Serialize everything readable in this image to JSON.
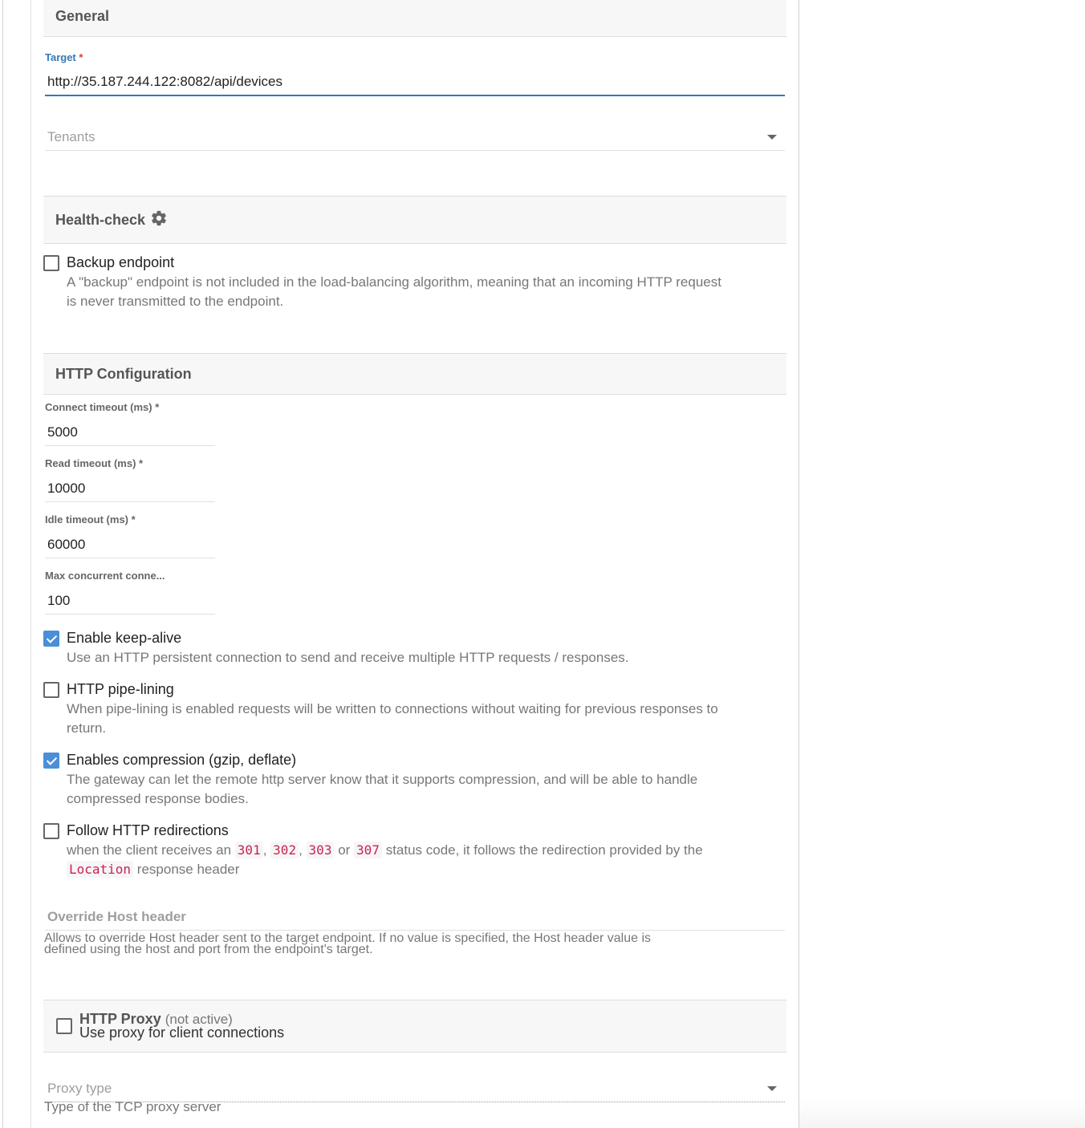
{
  "sections": {
    "general": "General",
    "health_check": "Health-check",
    "http_config": "HTTP Configuration"
  },
  "target": {
    "label": "Target",
    "required_mark": "*",
    "value": "http://35.187.244.122:8082/api/devices"
  },
  "tenants": {
    "placeholder": "Tenants"
  },
  "backup": {
    "label": "Backup endpoint",
    "checked": false,
    "desc_line1": "A \"backup\" endpoint is not included in the load-balancing algorithm, meaning that an incoming HTTP request",
    "desc_line2": "is never transmitted to the endpoint."
  },
  "timeouts": {
    "connect_label": "Connect timeout (ms) *",
    "connect_value": "5000",
    "read_label": "Read timeout (ms) *",
    "read_value": "10000",
    "idle_label": "Idle timeout (ms) *",
    "idle_value": "60000",
    "max_label": "Max concurrent conne...",
    "max_value": "100"
  },
  "keepalive": {
    "label": "Enable keep-alive",
    "checked": true,
    "desc": "Use an HTTP persistent connection to send and receive multiple HTTP requests / responses."
  },
  "pipelining": {
    "label": "HTTP pipe-lining",
    "checked": false,
    "desc_line1": "When pipe-lining is enabled requests will be written to connections without waiting for previous responses to",
    "desc_line2": "return."
  },
  "compression": {
    "label": "Enables compression (gzip, deflate)",
    "checked": true,
    "desc_line1": "The gateway can let the remote http server know that it supports compression, and will be able to handle",
    "desc_line2": "compressed response bodies."
  },
  "redirects": {
    "label": "Follow HTTP redirections",
    "checked": false,
    "desc_prefix": "when the client receives an",
    "code1": "301",
    "sep1": ",",
    "code2": "302",
    "sep2": ",",
    "code3": "303",
    "or": "or",
    "code4": "307",
    "desc_mid": "status code, it follows the redirection provided by the",
    "code5": "Location",
    "desc_suffix": "response header"
  },
  "override_host": {
    "label": "Override Host header",
    "desc_line1": "Allows to override Host header sent to the target endpoint. If no value is specified, the Host header value is",
    "desc_line2": "defined using the host and port from the endpoint's target."
  },
  "proxy": {
    "title": "HTTP Proxy",
    "status": "(not active)",
    "subtitle": "Use proxy for client connections",
    "checked": false,
    "type_placeholder": "Proxy type",
    "type_desc": "Type of the TCP proxy server"
  },
  "icons": {
    "health_check": "gear-icon",
    "dropdown": "caret-down-icon"
  },
  "colors": {
    "accent": "#337ab7",
    "checkbox_checked": "#4a8fd8",
    "code": "#c7254e"
  }
}
